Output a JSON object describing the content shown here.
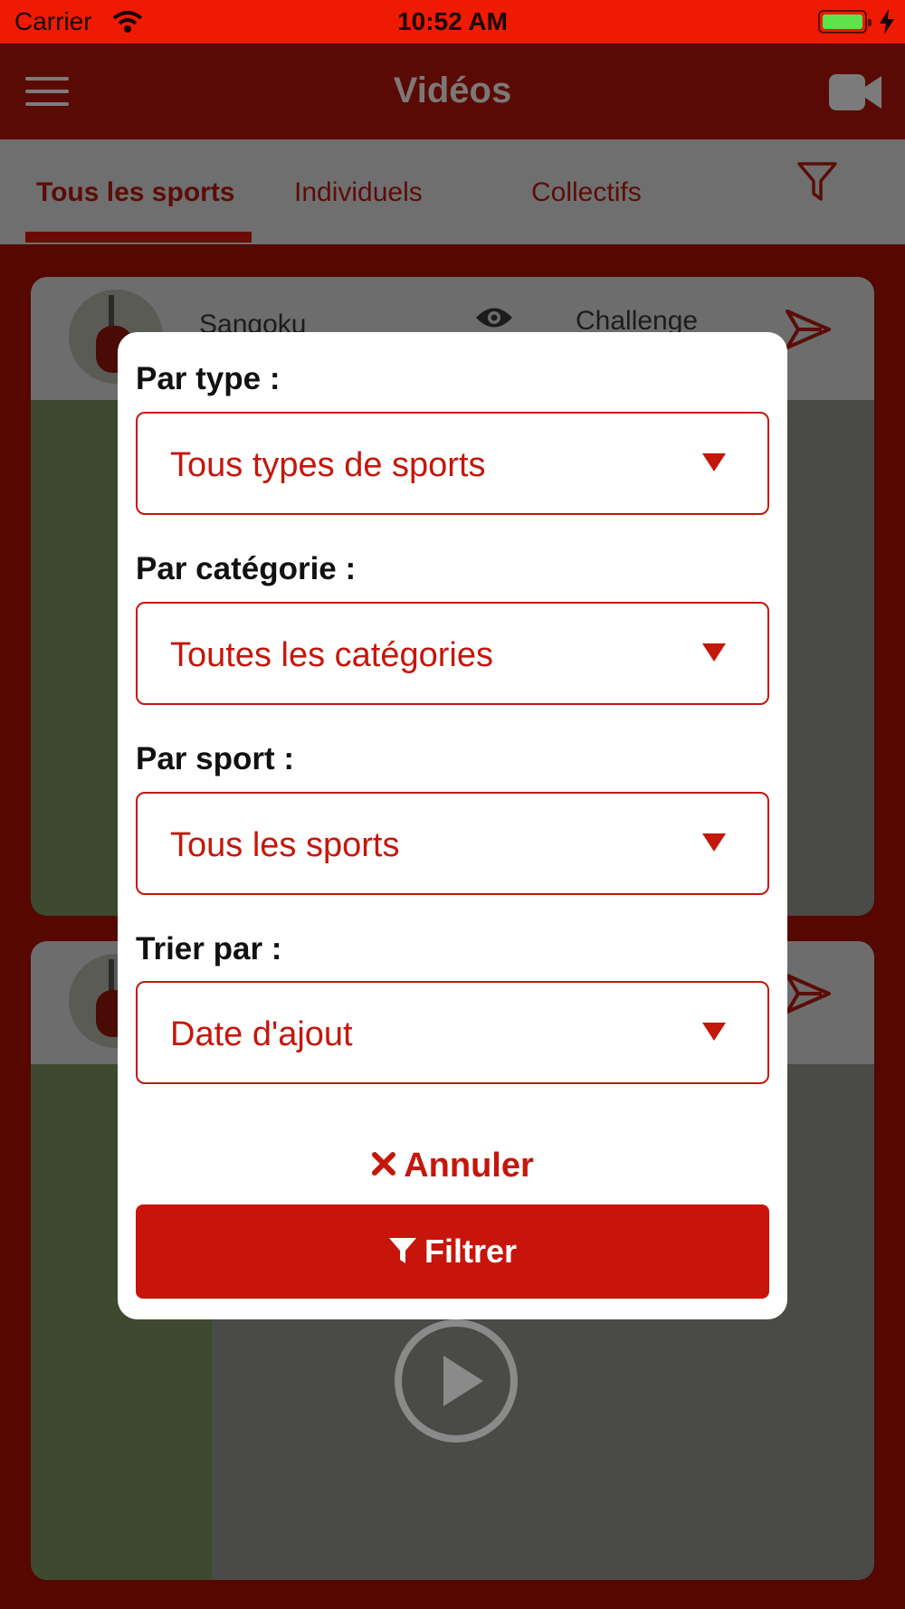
{
  "status_bar": {
    "carrier": "Carrier",
    "time": "10:52 AM"
  },
  "nav": {
    "title": "Vidéos"
  },
  "tabs": [
    {
      "label": "Tous les sports",
      "active": true
    },
    {
      "label": "Individuels",
      "active": false
    },
    {
      "label": "Collectifs",
      "active": false
    }
  ],
  "feed": [
    {
      "username": "Sangoku",
      "badge": "Challenge"
    },
    {
      "username": "",
      "badge": ""
    }
  ],
  "filter_modal": {
    "type_label": "Par type :",
    "type_value": "Tous types de sports",
    "category_label": "Par catégorie :",
    "category_value": "Toutes les catégories",
    "sport_label": "Par sport :",
    "sport_value": "Tous les sports",
    "sort_label": "Trier par :",
    "sort_value": "Date d'ajout",
    "cancel_label": "Annuler",
    "filter_label": "Filtrer"
  },
  "colors": {
    "accent": "#c4170c",
    "status_bar": "#ee1b02",
    "navbar": "#5a0a04"
  }
}
